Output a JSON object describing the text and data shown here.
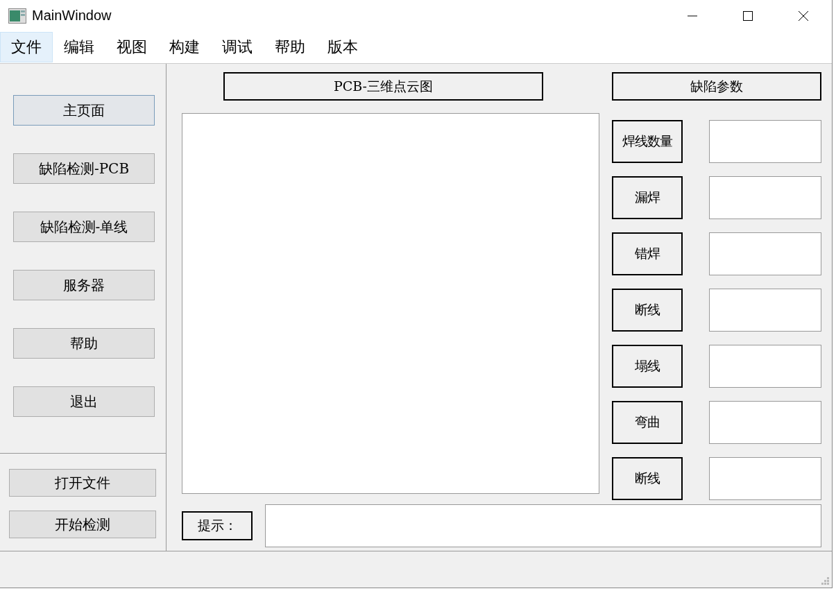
{
  "window": {
    "title": "MainWindow"
  },
  "menu": [
    {
      "label": "文件",
      "selected": true
    },
    {
      "label": "编辑",
      "selected": false
    },
    {
      "label": "视图",
      "selected": false
    },
    {
      "label": "构建",
      "selected": false
    },
    {
      "label": "调试",
      "selected": false
    },
    {
      "label": "帮助",
      "selected": false
    },
    {
      "label": "版本",
      "selected": false
    }
  ],
  "sidebar": {
    "items": [
      {
        "label": "主页面",
        "selected": true
      },
      {
        "label": "缺陷检测-PCB",
        "selected": false
      },
      {
        "label": "缺陷检测-单线",
        "selected": false
      },
      {
        "label": "服务器",
        "selected": false
      },
      {
        "label": "帮助",
        "selected": false
      },
      {
        "label": "退出",
        "selected": false
      }
    ],
    "actions": [
      "打开文件",
      "开始检测"
    ]
  },
  "plot": {
    "title": "PCB-三维点云图"
  },
  "params": {
    "title": "缺陷参数",
    "rows": [
      "焊线数量",
      "漏焊",
      "错焊",
      "断线",
      "塌线",
      "弯曲",
      "断线"
    ]
  },
  "hint": {
    "label": "提示："
  }
}
